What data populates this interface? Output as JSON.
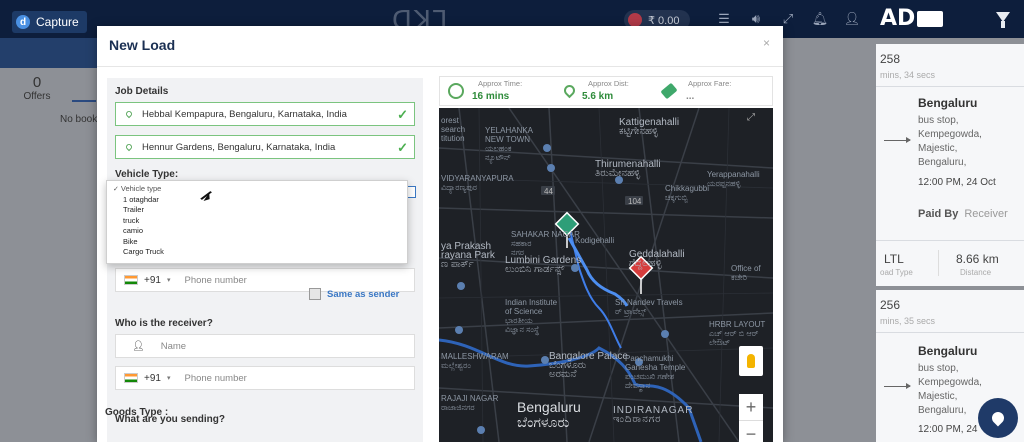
{
  "app": {
    "capture_label": "Capture",
    "wallet_amount": "₹ 0.00",
    "brand": "AD"
  },
  "background": {
    "offers_count": "0",
    "offers_label": "Offers",
    "no_bookings_text": "No book"
  },
  "cards": [
    {
      "id": "258",
      "mins": "mins, 34 secs",
      "city": "Bengaluru",
      "address": [
        "bus stop,",
        "Kempegowda,",
        "Majestic,",
        "Bengaluru,"
      ],
      "time": "12:00 PM, 24 Oct",
      "paid_by_label": "Paid By",
      "paid_by_value": "Receiver",
      "load_type_value": "LTL",
      "load_type_label": "oad Type",
      "distance_value": "8.66 km",
      "distance_label": "Distance"
    },
    {
      "id": "256",
      "mins": "mins, 35 secs",
      "city": "Bengaluru",
      "address": [
        "bus stop,",
        "Kempegowda,",
        "Majestic,",
        "Bengaluru,"
      ],
      "time": "12:00 PM, 24"
    }
  ],
  "modal": {
    "title": "New Load",
    "close": "×",
    "job_details_title": "Job Details",
    "pickup": "Hebbal Kempapura, Bengaluru, Karnataka, India",
    "dropoff": "Hennur Gardens, Bengaluru, Karnataka, India",
    "vehicle_type_label": "Vehicle Type:",
    "vehicle_options": [
      "Vehicle type",
      "1 otaghdar",
      "Trailer",
      "truck",
      "camio",
      "Bike",
      "Cargo Truck"
    ],
    "vehicle_selected": "Vehicle type",
    "sender_phone": {
      "country_code": "+91",
      "placeholder": "Phone number"
    },
    "receiver_title": "Who is the receiver?",
    "same_as_sender": "Same as sender",
    "receiver_name_placeholder": "Name",
    "receiver_phone": {
      "country_code": "+91",
      "placeholder": "Phone number"
    },
    "sending_title": "What are you sending?",
    "goods_type_label": "Goods Type :"
  },
  "map_stats": {
    "time_label": "Approx Time:",
    "time_value": "16 mins",
    "dist_label": "Approx Dist:",
    "dist_value": "5.6 km",
    "fare_label": "Approx Fare:",
    "fare_value": "..."
  },
  "map": {
    "labels": {
      "forest": "orest\nsearch\ntitution",
      "yelahanka": "YELAHANKA\nNEW TOWN\nಯಲಹಂಕ\nನ್ಯೂಟೌನ್",
      "kattigenahalli": "Kattigenahalli\nಕಟ್ಟಿಗೇನಹಳ್ಳಿ",
      "thirumena": "Thirumenahalli\nತಿರುಮೇನಹಳ್ಳಿ",
      "yerappanahalli": "Yerappanahalli\nಯರಪ್ಪನಹಳ್ಳಿ",
      "chikkagubbi": "Chikkagubbi\nಚಿಕ್ಕಗುಬ್ಬಿ",
      "vidyaranyapura": "VIDYARANYAPURA\nವಿದ್ಯಾರಣ್ಯಪುರ",
      "sahakar": "SAHAKAR NAGAR\nಸಹಕಾರ\nನಗರ",
      "kodigehalli": "Kodigehalli",
      "vprakash": "ya Prakash\nrayana Park\nಣ ಪಾರ್ಕ್",
      "lumbini": "Lumbini Gardens\nಲುಂಬಿನಿ ಗಾರ್ಡನ್ಸ್",
      "geddalahalli": "Geddalahalli\nಗೆದ್ದಲಹಳ್ಳಿ",
      "srinidhi": "Sri Nandev Travels\nರ್ ಟ್ರಾವೆಲ್ಸ್",
      "office": "Office of\nಕಚೇರಿ",
      "iisc": "Indian Institute\nof Science\nಭಾರತೀಯ\nವಿಜ್ಞಾನ ಸಂಸ್ಥೆ",
      "hrbr": "HRBR LAYOUT\nಎಚ್ ಆರ್ ಬಿ ಆರ್\nಲೇಔಟ್",
      "malleshwaram": "MALLESHWARAM\nಮಲ್ಲೇಶ್ವರಂ",
      "bangalore_palace": "Bangalore Palace\nಬೆಂಗಳೂರು\nಅರಮನೆ",
      "panchamukhi": "Panchamukhi\nGanesha Temple\nಪಂಚಮುಖಿ ಗಣೇಶ\nದೇವಸ್ಥಾನ",
      "rajaji": "RAJAJI NAGAR\nರಾಜಾಜಿನಗರ",
      "bengaluru": "Bengaluru\nಬೆಂಗಳೂರು",
      "indiranagar": "INDIRANAGAR\nಇಂದಿರಾನಗರ",
      "road_44": "44",
      "road_104": "104"
    }
  },
  "colors": {
    "navy": "#0d1e3c",
    "accent_blue": "#3b78c4",
    "success_green": "#4caf50",
    "pickup_marker": "#2e9e78",
    "drop_marker": "#d63c3c",
    "route": "#4d8ef0"
  }
}
